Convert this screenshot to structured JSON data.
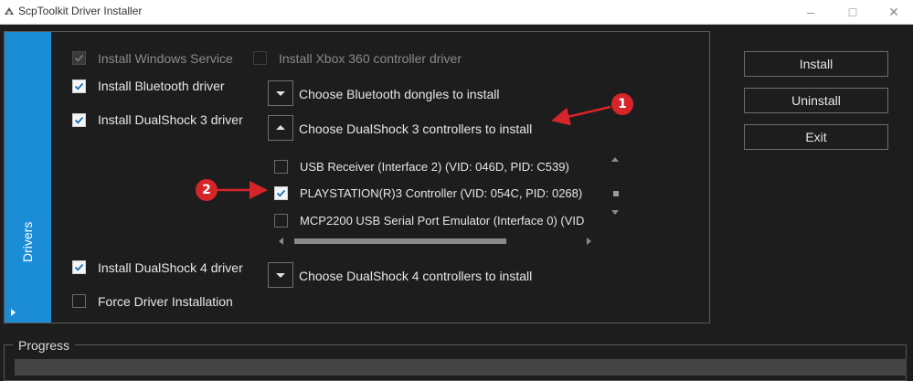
{
  "window": {
    "title": "ScpToolkit Driver Installer",
    "minimize_icon": "minimize-icon",
    "maximize_icon": "maximize-icon",
    "close_icon": "close-icon"
  },
  "sidebar": {
    "tab_label": "Drivers"
  },
  "options": {
    "install_windows_service": {
      "label": "Install Windows Service",
      "checked": true,
      "enabled": false
    },
    "install_xbox360": {
      "label": "Install Xbox 360 controller driver",
      "checked": false,
      "enabled": false
    },
    "install_bluetooth": {
      "label": "Install Bluetooth driver",
      "checked": true,
      "enabled": true
    },
    "install_ds3": {
      "label": "Install DualShock 3 driver",
      "checked": true,
      "enabled": true
    },
    "install_ds4": {
      "label": "Install DualShock 4 driver",
      "checked": true,
      "enabled": true
    },
    "force_install": {
      "label": "Force Driver Installation",
      "checked": false,
      "enabled": true
    }
  },
  "dropdowns": {
    "bluetooth": {
      "label": "Choose Bluetooth dongles to install",
      "expanded": false
    },
    "ds3": {
      "label": "Choose DualShock 3 controllers to install",
      "expanded": true
    },
    "ds4": {
      "label": "Choose DualShock 4 controllers to install",
      "expanded": false
    }
  },
  "ds3_devices": [
    {
      "label": "USB Receiver (Interface 2) (VID: 046D, PID: C539)",
      "checked": false
    },
    {
      "label": "PLAYSTATION(R)3 Controller (VID: 054C, PID: 0268)",
      "checked": true
    },
    {
      "label": "MCP2200 USB Serial Port Emulator (Interface 0) (VID",
      "checked": false
    }
  ],
  "buttons": {
    "install": "Install",
    "uninstall": "Uninstall",
    "exit": "Exit"
  },
  "progress": {
    "label": "Progress"
  },
  "annotations": {
    "badge1": "1",
    "badge2": "2"
  },
  "colors": {
    "accent": "#1b8cd6",
    "annotation_red": "#d6252a",
    "background": "#1d1d1d"
  }
}
